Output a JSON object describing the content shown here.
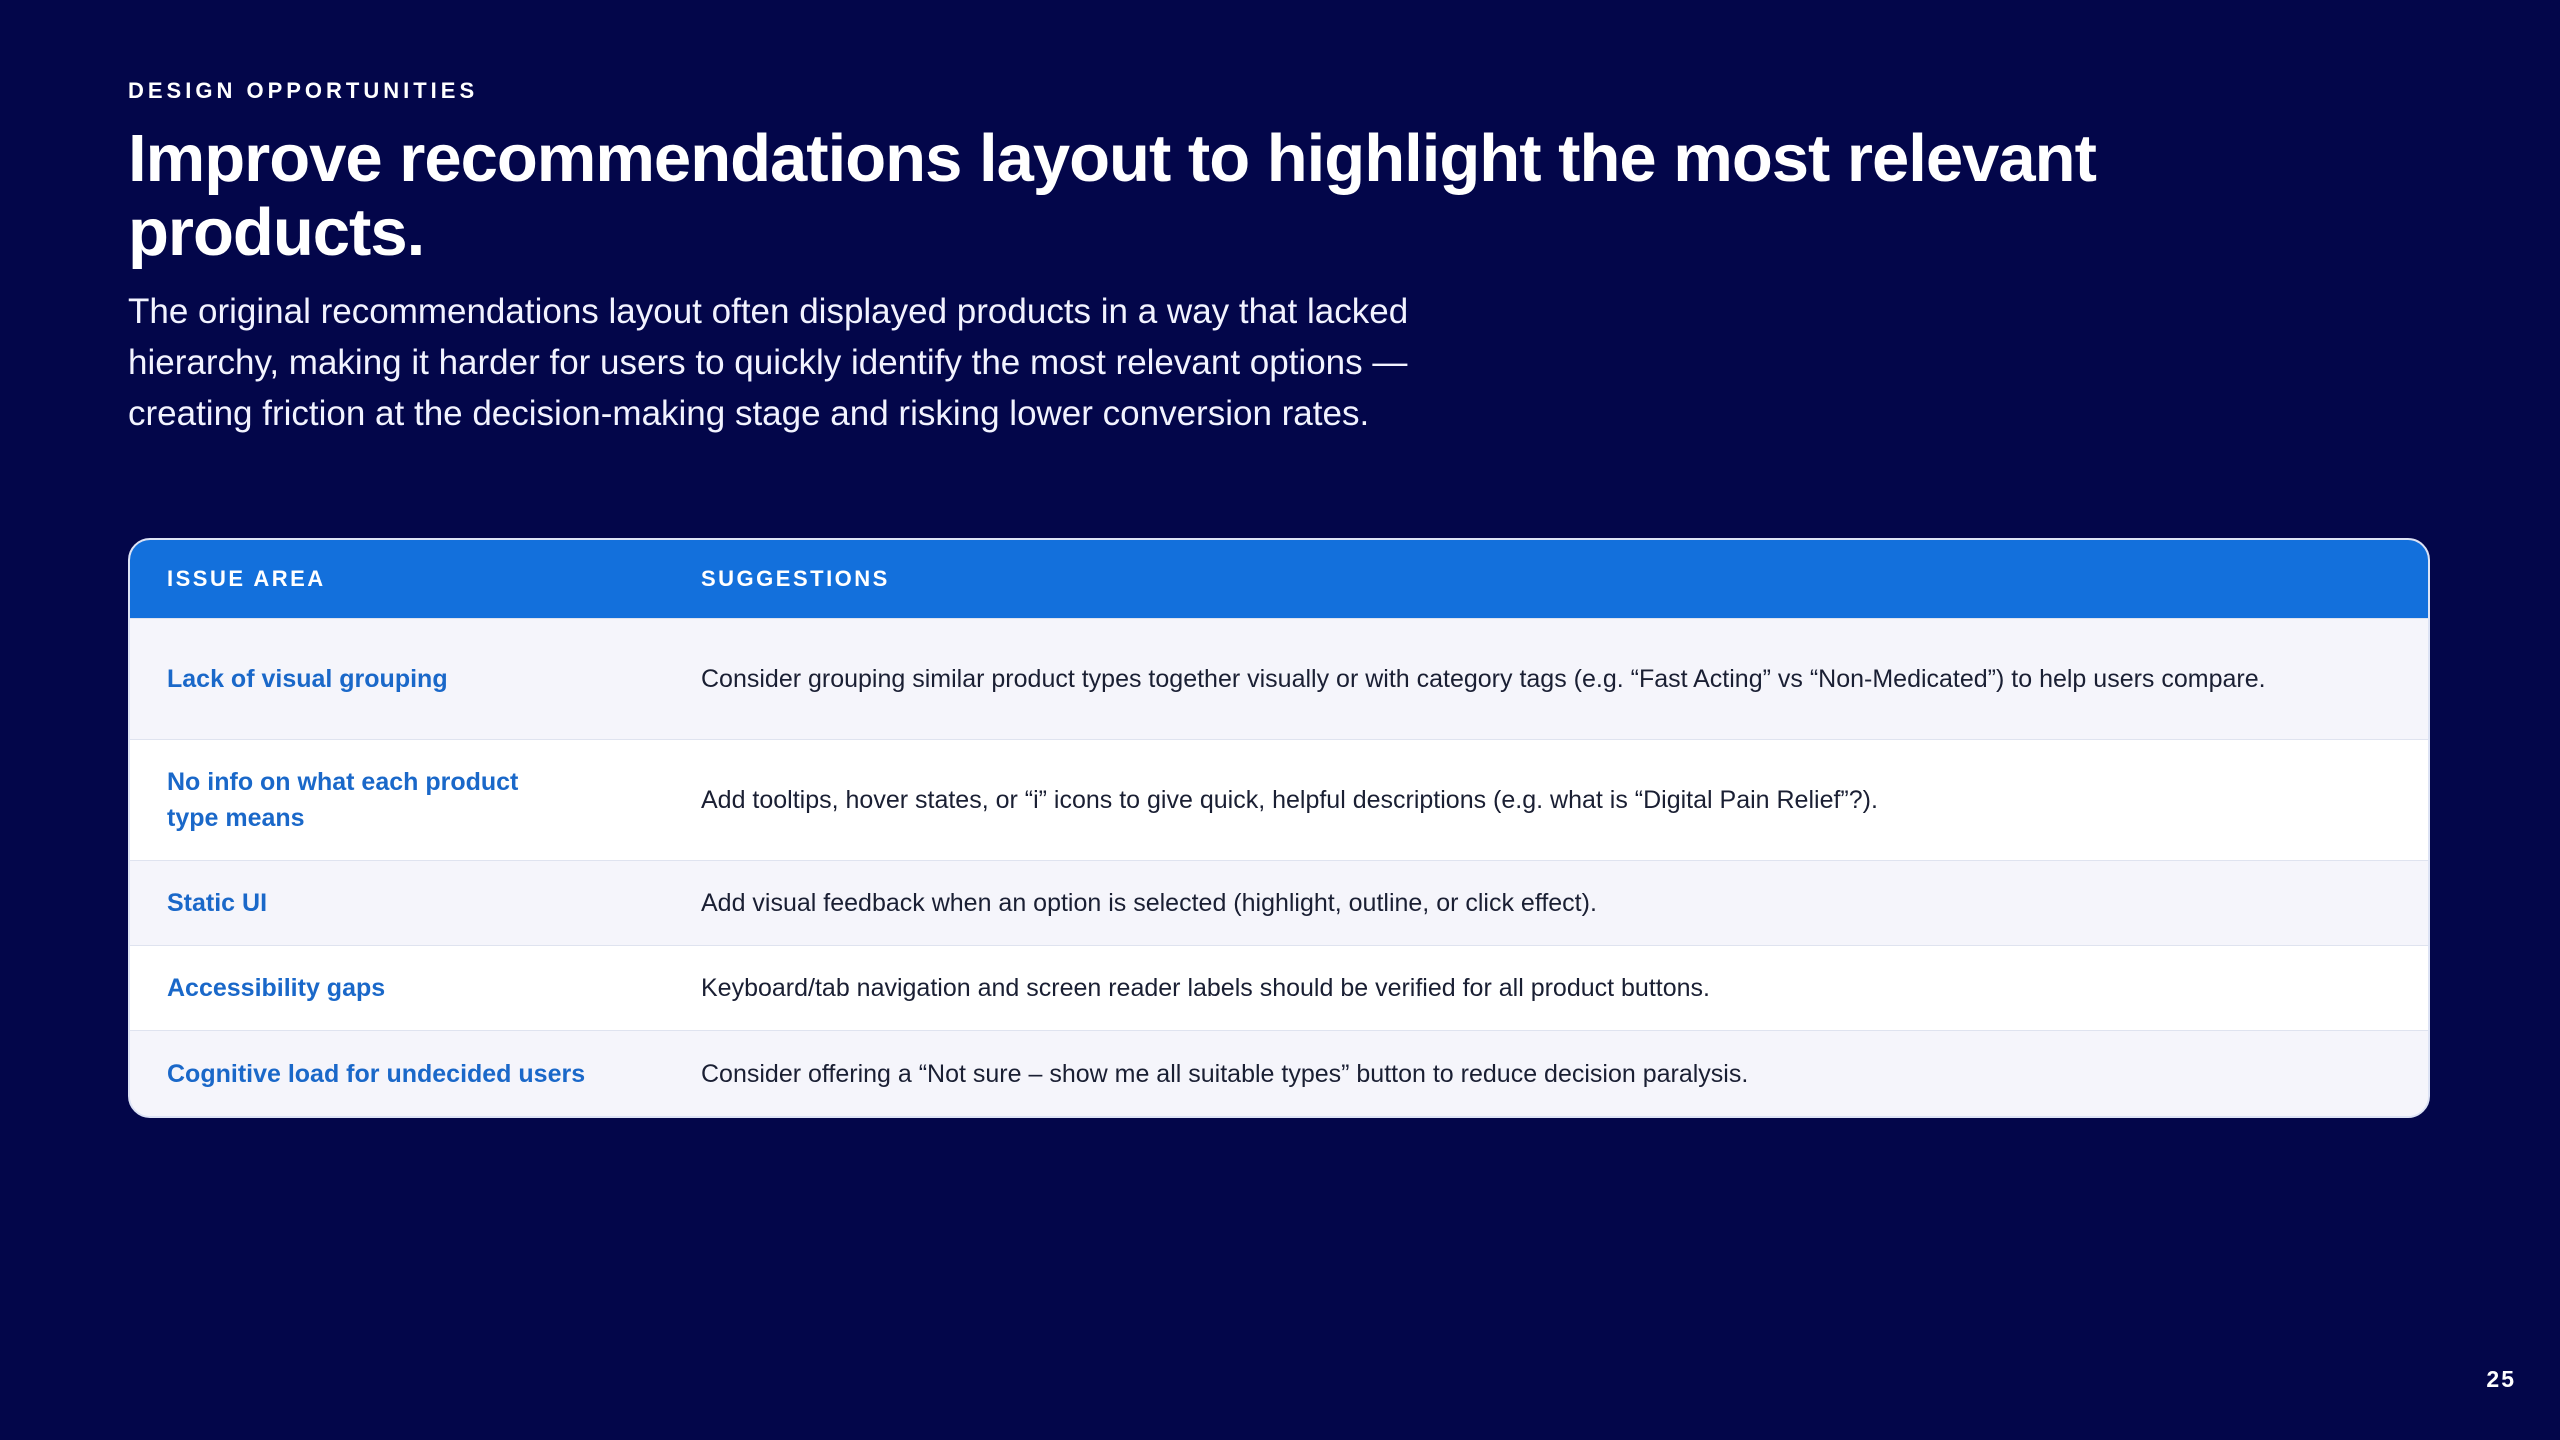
{
  "eyebrow": "DESIGN OPPORTUNITIES",
  "title": "Improve recommendations layout to highlight the most relevant products.",
  "subtitle": "The original recommendations layout often displayed products in a way that lacked hierarchy, making it harder for users to quickly identify the most relevant options — creating friction at the decision-making stage and risking lower conversion rates.",
  "table": {
    "headers": {
      "issue": "ISSUE AREA",
      "suggestion": "SUGGESTIONS"
    },
    "rows": [
      {
        "issue": "Lack of visual grouping",
        "suggestion": "Consider grouping similar product types together visually or with category tags (e.g. “Fast Acting” vs “Non-Medicated”) to help users compare."
      },
      {
        "issue": "No info on what each product type means",
        "suggestion": "Add tooltips, hover states, or “i” icons to give quick, helpful descriptions (e.g. what is “Digital Pain Relief”?)."
      },
      {
        "issue": "Static UI",
        "suggestion": "Add visual feedback when an option is selected (highlight, outline, or click effect)."
      },
      {
        "issue": "Accessibility gaps",
        "suggestion": "Keyboard/tab navigation and screen reader labels should be verified for all product buttons."
      },
      {
        "issue": "Cognitive load for undecided users",
        "suggestion": "Consider offering a “Not sure – show me all suitable types” button to reduce decision paralysis."
      }
    ]
  },
  "page_number": "25",
  "colors": {
    "background": "#03064a",
    "header": "#1370dc",
    "issue_text": "#1a68c9",
    "row_alt": "#f5f5fb"
  }
}
